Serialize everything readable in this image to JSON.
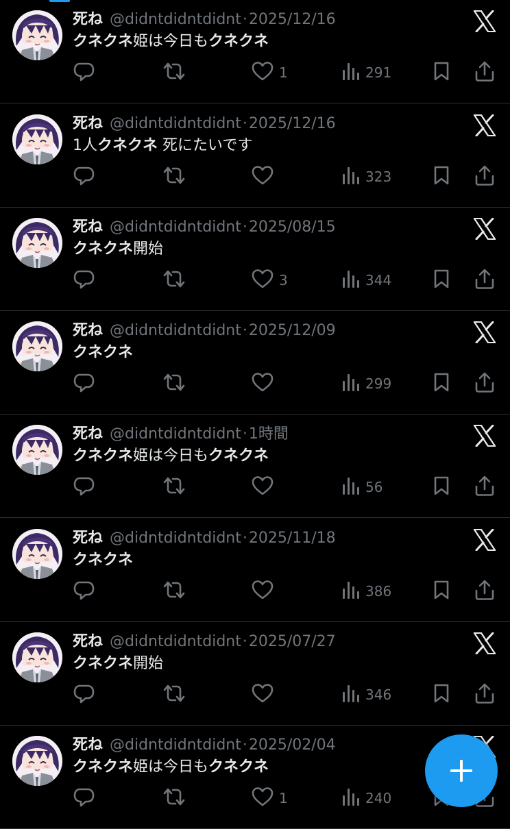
{
  "accent_color": "#1d9bf0",
  "tweets": [
    {
      "name": "死ね",
      "handle": "@didntdidntdidnt",
      "sep": "·",
      "time": "2025/12/16",
      "text": [
        {
          "t": "クネクネ",
          "b": true
        },
        {
          "t": "姫は今日も",
          "b": false
        },
        {
          "t": "クネクネ",
          "b": true
        }
      ],
      "likes": "1",
      "views": "291"
    },
    {
      "name": "死ね",
      "handle": "@didntdidntdidnt",
      "sep": "·",
      "time": "2025/12/16",
      "text": [
        {
          "t": "1人",
          "b": false
        },
        {
          "t": "クネクネ",
          "b": true
        },
        {
          "t": " 死にたいです",
          "b": false
        }
      ],
      "likes": "",
      "views": "323"
    },
    {
      "name": "死ね",
      "handle": "@didntdidntdidnt",
      "sep": "·",
      "time": "2025/08/15",
      "text": [
        {
          "t": "クネクネ",
          "b": true
        },
        {
          "t": "開始",
          "b": false
        }
      ],
      "likes": "3",
      "views": "344"
    },
    {
      "name": "死ね",
      "handle": "@didntdidntdidnt",
      "sep": "·",
      "time": "2025/12/09",
      "text": [
        {
          "t": "クネクネ",
          "b": true
        }
      ],
      "likes": "",
      "views": "299"
    },
    {
      "name": "死ね",
      "handle": "@didntdidntdidnt",
      "sep": "·",
      "time": "1時間",
      "text": [
        {
          "t": "クネクネ",
          "b": true
        },
        {
          "t": "姫は今日も",
          "b": false
        },
        {
          "t": "クネクネ",
          "b": true
        }
      ],
      "likes": "",
      "views": "56"
    },
    {
      "name": "死ね",
      "handle": "@didntdidntdidnt",
      "sep": "·",
      "time": "2025/11/18",
      "text": [
        {
          "t": "クネクネ",
          "b": true
        }
      ],
      "likes": "",
      "views": "386"
    },
    {
      "name": "死ね",
      "handle": "@didntdidntdidnt",
      "sep": "·",
      "time": "2025/07/27",
      "text": [
        {
          "t": "クネクネ",
          "b": true
        },
        {
          "t": "開始",
          "b": false
        }
      ],
      "likes": "",
      "views": "346"
    },
    {
      "name": "死ね",
      "handle": "@didntdidntdidnt",
      "sep": "·",
      "time": "2025/02/04",
      "text": [
        {
          "t": "クネクネ",
          "b": true
        },
        {
          "t": "姫は今日も",
          "b": false
        },
        {
          "t": "クネクネ",
          "b": true
        }
      ],
      "likes": "1",
      "views": "240"
    }
  ],
  "icons": {
    "avatar": "anime-avatar-icon",
    "logo": "x-logo-icon",
    "reply": "reply-icon",
    "retweet": "retweet-icon",
    "like": "heart-icon",
    "views": "views-chart-icon",
    "bookmark": "bookmark-icon",
    "share": "share-icon",
    "compose": "plus-icon"
  }
}
